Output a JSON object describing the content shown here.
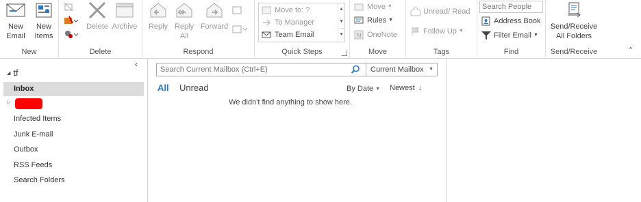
{
  "ribbon": {
    "new_group": {
      "label": "New",
      "new_email": "New\nEmail",
      "new_items": "New\nItems"
    },
    "delete_group": {
      "label": "Delete",
      "delete": "Delete",
      "archive": "Archive"
    },
    "respond_group": {
      "label": "Respond",
      "reply": "Reply",
      "reply_all": "Reply\nAll",
      "forward": "Forward"
    },
    "quick_steps_group": {
      "label": "Quick Steps",
      "items": [
        "Move to: ?",
        "To Manager",
        "Team Email"
      ]
    },
    "move_group": {
      "label": "Move",
      "move": "Move",
      "rules": "Rules",
      "onenote": "OneNote"
    },
    "tags_group": {
      "label": "Tags",
      "unread_read": "Unread/ Read",
      "follow_up": "Follow Up"
    },
    "find_group": {
      "label": "Find",
      "search_people_placeholder": "Search People",
      "address_book": "Address Book",
      "filter_email": "Filter Email"
    },
    "send_receive_group": {
      "label": "Send/Receive",
      "send_receive_all": "Send/Receive\nAll Folders"
    }
  },
  "folders": {
    "account": "tf",
    "items": [
      "Inbox",
      "",
      "Infected Items",
      "Junk E-mail",
      "Outbox",
      "RSS Feeds",
      "Search Folders"
    ],
    "selected": "Inbox",
    "redacted_color": "#ff0000"
  },
  "mail_list": {
    "search_placeholder": "Search Current Mailbox (Ctrl+E)",
    "scope": "Current Mailbox",
    "filter_all": "All",
    "filter_unread": "Unread",
    "sort_by": "By Date",
    "sort_order": "Newest",
    "empty_message": "We didn't find anything to show here."
  },
  "colors": {
    "accent": "#2b79c2",
    "selected_bg": "#dcdcdc",
    "disabled_text": "#9a9a9a"
  }
}
